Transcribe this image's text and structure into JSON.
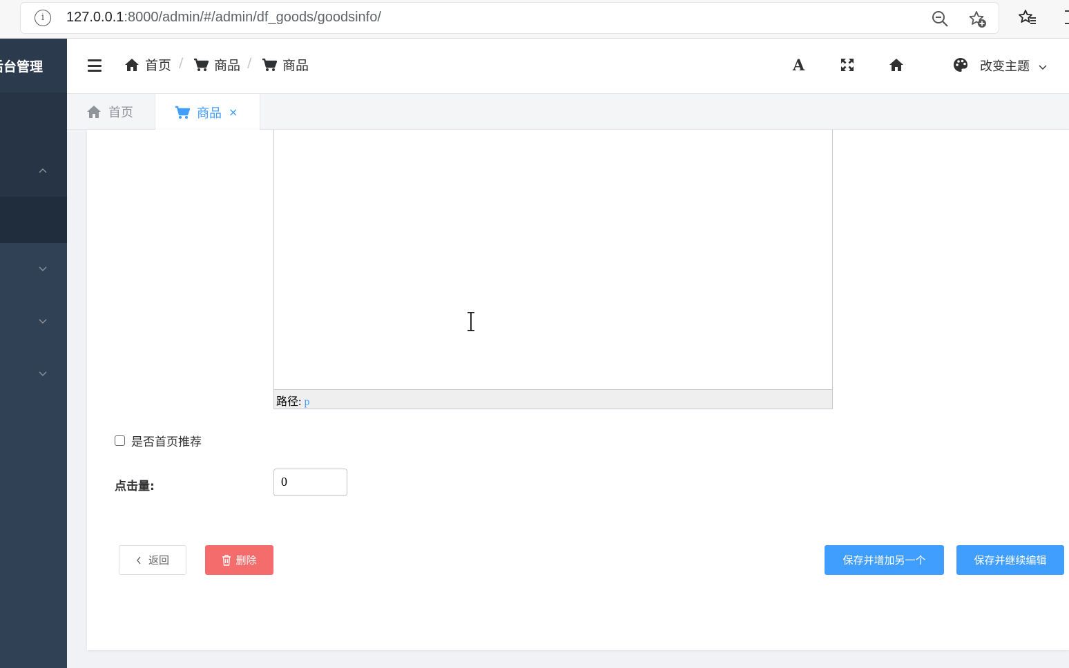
{
  "browser": {
    "url_host": "127.0.0.1",
    "url_rest": ":8000/admin/#/admin/df_goods/goodsinfo/"
  },
  "sidebar": {
    "logo": "后台管理"
  },
  "header": {
    "breadcrumb": [
      "首页",
      "商品",
      "商品"
    ],
    "theme_label": "改变主题",
    "font_icon_letter": "A"
  },
  "tabs": [
    {
      "label": "首页"
    },
    {
      "label": "商品",
      "close": "×"
    }
  ],
  "editor": {
    "path_label": "路径",
    "path_sep": ": ",
    "path_value": "p"
  },
  "form": {
    "recommend_label": "是否首页推荐",
    "recommend_checked": false,
    "clicks_label": "点击量:",
    "clicks_value": "0"
  },
  "buttons": {
    "back": "返回",
    "delete": "删除",
    "save_add": "保存并增加另一个",
    "save_continue": "保存并继续编辑"
  },
  "colors": {
    "primary": "#409eff",
    "danger": "#f56c6c",
    "sidebar": "#304156"
  }
}
